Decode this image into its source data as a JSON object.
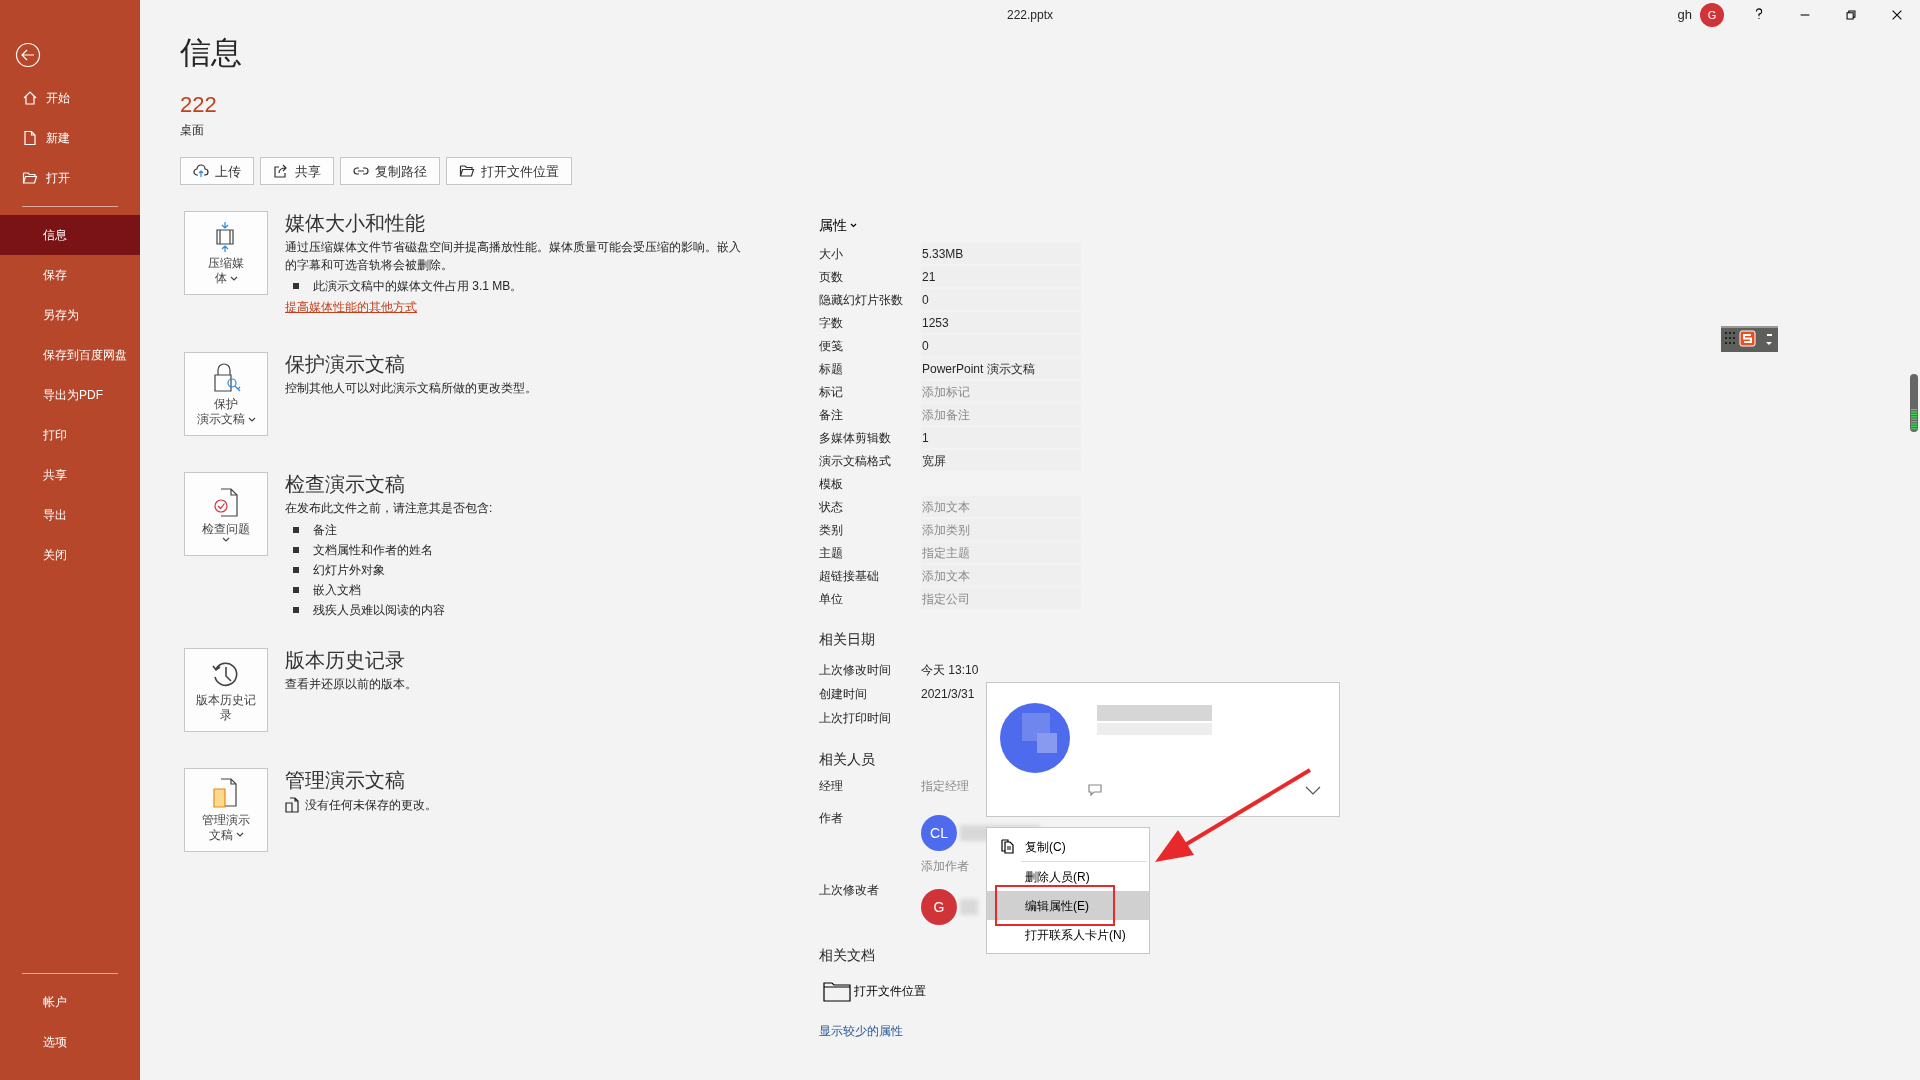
{
  "window": {
    "title": "222.pptx",
    "user": "gh",
    "avatar": "G"
  },
  "sidebar": {
    "top_items": [
      {
        "label": "开始",
        "selected": false
      },
      {
        "label": "新建",
        "selected": false
      },
      {
        "label": "打开",
        "selected": false
      }
    ],
    "items": [
      {
        "label": "信息",
        "selected": true
      },
      {
        "label": "保存",
        "selected": false
      },
      {
        "label": "另存为",
        "selected": false
      },
      {
        "label": "保存到百度网盘",
        "selected": false
      },
      {
        "label": "导出为PDF",
        "selected": false
      },
      {
        "label": "打印",
        "selected": false
      },
      {
        "label": "共享",
        "selected": false
      },
      {
        "label": "导出",
        "selected": false
      },
      {
        "label": "关闭",
        "selected": false
      }
    ],
    "bottom_items": [
      {
        "label": "帐户",
        "selected": false
      },
      {
        "label": "选项",
        "selected": false
      }
    ]
  },
  "page": {
    "heading": "信息",
    "file_name": "222",
    "location": "桌面"
  },
  "actions": [
    {
      "label": "上传"
    },
    {
      "label": "共享"
    },
    {
      "label": "复制路径"
    },
    {
      "label": "打开文件位置"
    }
  ],
  "sections": [
    {
      "button_lines": [
        "压缩媒",
        "体"
      ],
      "dropdown": true,
      "title": "媒体大小和性能",
      "description": "通过压缩媒体文件节省磁盘空间并提高播放性能。媒体质量可能会受压缩的影响。嵌入的字幕和可选音轨将会被删除。",
      "bullets": [
        "此演示文稿中的媒体文件占用 3.1 MB。"
      ],
      "link": "提高媒体性能的其他方式"
    },
    {
      "button_lines": [
        "保护",
        "演示文稿"
      ],
      "dropdown": true,
      "title": "保护演示文稿",
      "description": "控制其他人可以对此演示文稿所做的更改类型。"
    },
    {
      "button_lines": [
        "检查问题"
      ],
      "dropdown": true,
      "title": "检查演示文稿",
      "description": "在发布此文件之前，请注意其是否包含:",
      "bullets": [
        "备注",
        "文档属性和作者的姓名",
        "幻灯片外对象",
        "嵌入文档",
        "残疾人员难以阅读的内容"
      ]
    },
    {
      "button_lines": [
        "版本历史记",
        "录"
      ],
      "dropdown": false,
      "title": "版本历史记录",
      "description": "查看并还原以前的版本。"
    },
    {
      "button_lines": [
        "管理演示",
        "文稿"
      ],
      "dropdown": true,
      "title": "管理演示文稿",
      "note": "没有任何未保存的更改。"
    }
  ],
  "properties": {
    "heading": "属性",
    "rows": [
      {
        "label": "大小",
        "value": "5.33MB"
      },
      {
        "label": "页数",
        "value": "21"
      },
      {
        "label": "隐藏幻灯片张数",
        "value": "0"
      },
      {
        "label": "字数",
        "value": "1253"
      },
      {
        "label": "便笺",
        "value": "0"
      },
      {
        "label": "标题",
        "value": "PowerPoint 演示文稿"
      },
      {
        "label": "标记",
        "placeholder": "添加标记"
      },
      {
        "label": "备注",
        "placeholder": "添加备注"
      },
      {
        "label": "多媒体剪辑数",
        "value": "1"
      },
      {
        "label": "演示文稿格式",
        "value": "宽屏"
      },
      {
        "label": "模板"
      },
      {
        "label": "状态",
        "placeholder": "添加文本"
      },
      {
        "label": "类别",
        "placeholder": "添加类别"
      },
      {
        "label": "主题",
        "placeholder": "指定主题"
      },
      {
        "label": "超链接基础",
        "placeholder": "添加文本"
      },
      {
        "label": "单位",
        "placeholder": "指定公司"
      }
    ]
  },
  "dates": {
    "heading": "相关日期",
    "rows": [
      {
        "label": "上次修改时间",
        "value": "今天 13:10"
      },
      {
        "label": "创建时间",
        "value": "2021/3/31"
      },
      {
        "label": "上次打印时间"
      }
    ]
  },
  "people": {
    "heading": "相关人员",
    "manager": {
      "label": "经理",
      "placeholder": "指定经理"
    },
    "author": {
      "label": "作者",
      "avatar": "CL",
      "color": "#4f6bed",
      "add": "添加作者"
    },
    "last_modified_by": {
      "label": "上次修改者",
      "avatar": "G",
      "color": "#d13438"
    }
  },
  "related_docs": {
    "heading": "相关文档",
    "open_location": "打开文件位置"
  },
  "show_less": "显示较少的属性",
  "contact_card": {
    "kind": "blurred"
  },
  "context_menu": {
    "items": [
      {
        "label": "复制(C)",
        "selected": false,
        "annotated": false
      },
      {
        "label": "删除人员(R)",
        "selected": false,
        "annotated": false
      },
      {
        "label": "编辑属性(E)",
        "selected": true,
        "annotated": true
      },
      {
        "label": "打开联系人卡片(N)",
        "selected": false,
        "annotated": false
      }
    ]
  }
}
